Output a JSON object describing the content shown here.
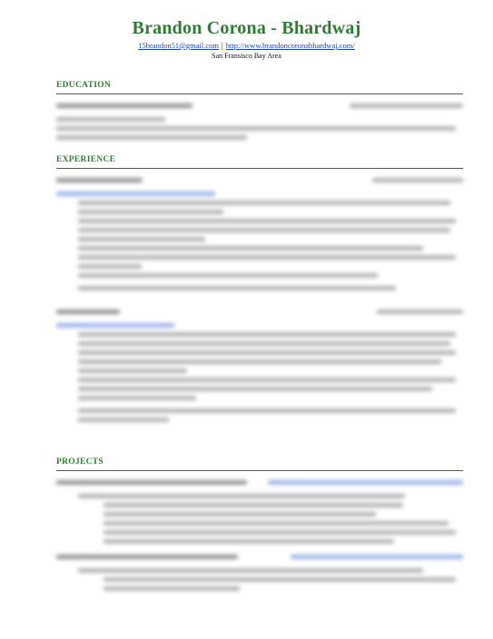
{
  "header": {
    "name": "Brandon Corona - Bhardwaj",
    "email": "15brandon51@gmail.com",
    "separator": "|",
    "website": "http://www.brandoncoronabhardwaj.com/",
    "location": "San Fransisco Bay Area"
  },
  "sections": {
    "education": "EDUCATION",
    "experience": "EXPERIENCE",
    "projects": "PROJECTS"
  },
  "colors": {
    "heading": "#2e7d32",
    "link": "#1a3fc4"
  }
}
